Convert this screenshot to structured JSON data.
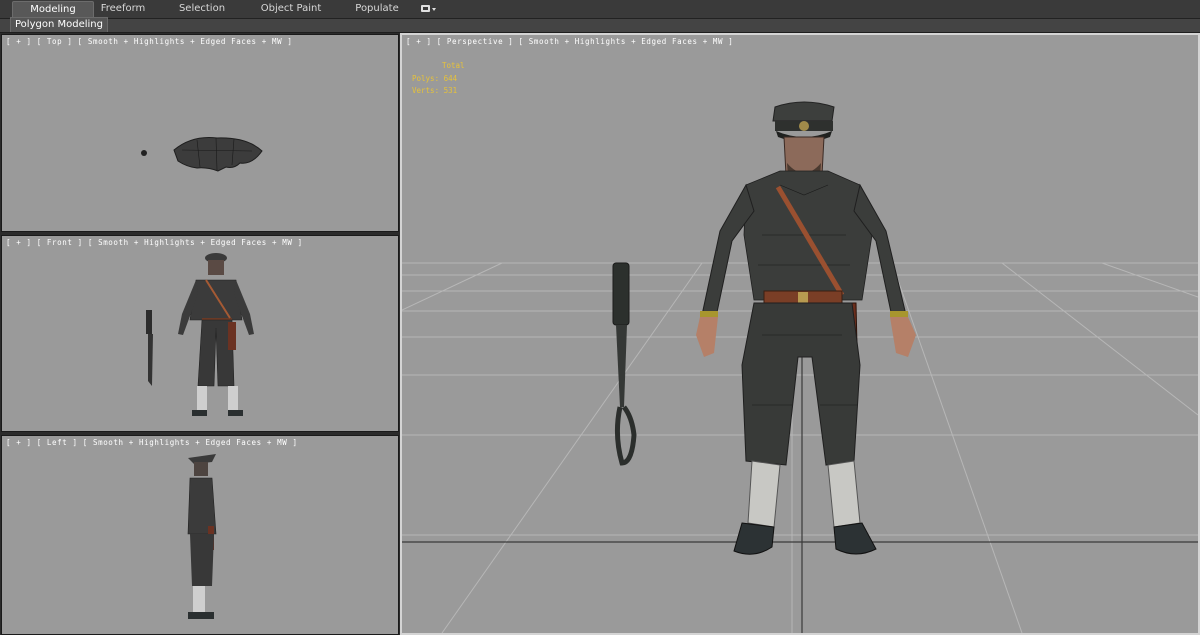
{
  "ribbon": {
    "tabs": [
      {
        "label": "Modeling",
        "active": true
      },
      {
        "label": "Freeform",
        "active": false
      },
      {
        "label": "Selection",
        "active": false
      },
      {
        "label": "Object Paint",
        "active": false
      },
      {
        "label": "Populate",
        "active": false
      }
    ],
    "panel_label": "Polygon Modeling"
  },
  "viewports": {
    "top": {
      "label": "[ + ] [ Top ] [ Smooth + Highlights + Edged Faces + MW ]"
    },
    "front": {
      "label": "[ + ] [ Front ] [ Smooth + Highlights + Edged Faces + MW ]"
    },
    "left": {
      "label": "[ + ] [ Left ] [ Smooth + Highlights + Edged Faces + MW ]"
    },
    "perspective": {
      "label": "[ + ] [ Perspective ] [ Smooth + Highlights + Edged Faces + MW ]"
    }
  },
  "stats": {
    "total_label": "Total",
    "polys": "Polys: 644",
    "verts": "Verts: 531"
  },
  "colors": {
    "viewport_bg": "#9a9a9a",
    "stats_text": "#e6c23a",
    "uniform": "#3b3b3b",
    "strap": "#8b4a2c"
  }
}
